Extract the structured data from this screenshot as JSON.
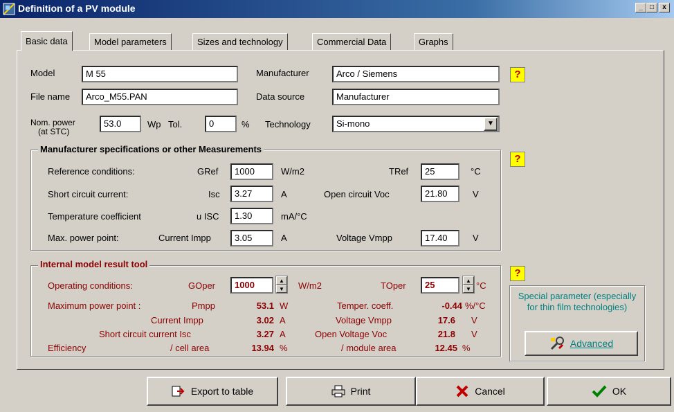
{
  "window": {
    "title": "Definition of a PV module",
    "min": "_",
    "max": "□",
    "close": "x"
  },
  "tabs": [
    "Basic data",
    "Model parameters",
    "Sizes and technology",
    "Commercial Data",
    "Graphs"
  ],
  "basic": {
    "model_label": "Model",
    "model_value": "M 55",
    "manufacturer_label": "Manufacturer",
    "manufacturer_value": "Arco / Siemens",
    "file_label": "File name",
    "file_value": "Arco_M55.PAN",
    "source_label": "Data source",
    "source_value": "Manufacturer",
    "nompower_label1": "Nom. power",
    "nompower_label2": "(at STC)",
    "nompower_value": "53.0",
    "nompower_unit": "Wp",
    "tol_label": "Tol.",
    "tol_value": "0",
    "tol_unit": "%",
    "tech_label": "Technology",
    "tech_value": "Si-mono",
    "help": "?"
  },
  "specs": {
    "title": "Manufacturer specifications  or  other Measurements",
    "ref_label": "Reference conditions:",
    "gref_label": "GRef",
    "gref_value": "1000",
    "gref_unit": "W/m2",
    "tref_label": "TRef",
    "tref_value": "25",
    "tref_unit": "°C",
    "isc_label": "Short circuit current:",
    "isc_sym": "Isc",
    "isc_value": "3.27",
    "isc_unit": "A",
    "voc_label": "Open circuit Voc",
    "voc_value": "21.80",
    "voc_unit": "V",
    "tc_label": "Temperature coefficient",
    "tc_sym": "u ISC",
    "tc_value": "1.30",
    "tc_unit": "mA/°C",
    "mpp_label": "Max. power point:",
    "impp_label": "Current Impp",
    "impp_value": "3.05",
    "impp_unit": "A",
    "vmpp_label": "Voltage Vmpp",
    "vmpp_value": "17.40",
    "vmpp_unit": "V"
  },
  "tool": {
    "title": "Internal model result tool",
    "op_label": "Operating conditions:",
    "goper_label": "GOper",
    "goper_value": "1000",
    "goper_unit": "W/m2",
    "toper_label": "TOper",
    "toper_value": "25",
    "toper_unit": "°C",
    "mpp_label": "Maximum power point :",
    "pmpp_label": "Pmpp",
    "pmpp_value": "53.1",
    "pmpp_unit": "W",
    "tcoeff_label": "Temper. coeff.",
    "tcoeff_value": "-0.44",
    "tcoeff_unit": "%/°C",
    "impp_label": "Current  Impp",
    "impp_value": "3.02",
    "impp_unit": "A",
    "vmpp_label": "Voltage Vmpp",
    "vmpp_value": "17.6",
    "vmpp_unit": "V",
    "isc_label": "Short circuit current  Isc",
    "isc_value": "3.27",
    "isc_unit": "A",
    "voc_label": "Open Voltage Voc",
    "voc_value": "21.8",
    "voc_unit": "V",
    "eff_label": "Efficiency",
    "cell_label": "/ cell area",
    "cell_value": "13.94",
    "cell_unit": "%",
    "module_label": "/ module area",
    "module_value": "12.45",
    "module_unit": "%"
  },
  "special": {
    "text": "Special parameter (especially for thin film technologies)",
    "button": "Advanced"
  },
  "buttons": {
    "export": "Export to table",
    "print": "Print",
    "cancel": "Cancel",
    "ok": "OK"
  },
  "colors": {
    "title_start": "#0a246a",
    "title_end": "#a6caf0",
    "tool_text": "#8b0000",
    "special_text": "#008080",
    "help_bg": "#ffff00"
  }
}
